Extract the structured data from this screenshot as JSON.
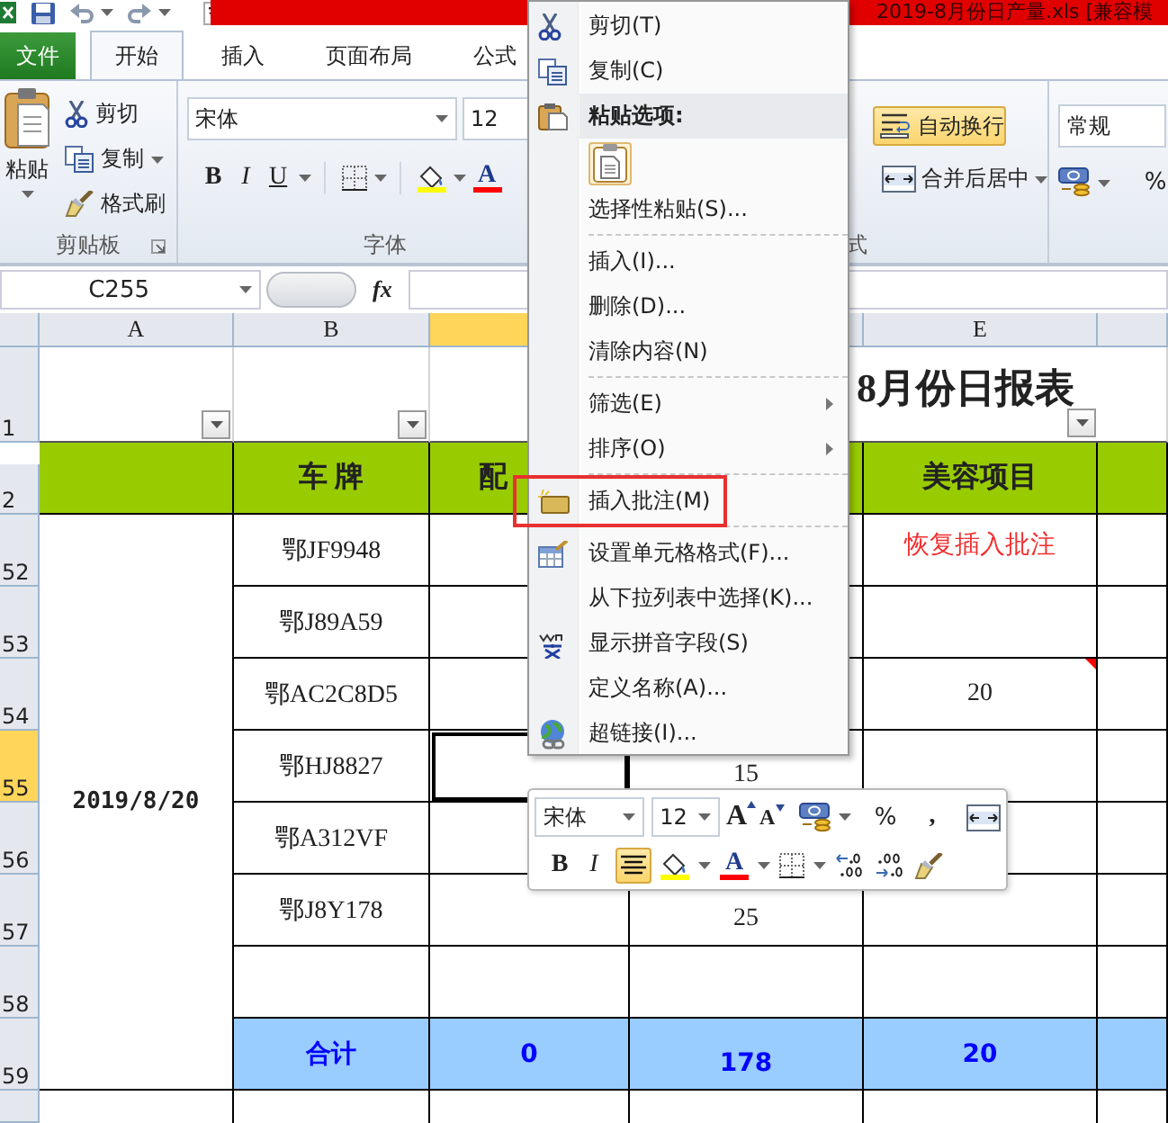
{
  "window": {
    "title": "2019-8月份日产量.xls  [兼容模"
  },
  "tabs": [
    {
      "label": "文件",
      "kind": "file",
      "selected": false
    },
    {
      "label": "开始",
      "kind": "tab",
      "selected": true
    },
    {
      "label": "插入",
      "kind": "tab",
      "selected": false
    },
    {
      "label": "页面布局",
      "kind": "tab",
      "selected": false
    },
    {
      "label": "公式",
      "kind": "tab",
      "selected": false
    }
  ],
  "ribbon": {
    "clipboard": {
      "paste": "粘贴",
      "cut": "剪切",
      "copy": "复制",
      "painter": "格式刷",
      "label": "剪贴板"
    },
    "font": {
      "name": "宋体",
      "size": "12",
      "bold": "B",
      "italic": "I",
      "underline": "U",
      "font_color_button": "A",
      "label": "字体"
    },
    "alignment": {
      "label": "式",
      "wrap": {
        "label": "自动换行",
        "on": true
      },
      "merge": "合并后居中"
    },
    "number": {
      "format": "常规",
      "percent": "%"
    }
  },
  "formula_bar": {
    "name_box": "C255",
    "fx": "fx"
  },
  "sheet": {
    "columns": [
      {
        "label": "A",
        "selected": false
      },
      {
        "label": "B",
        "selected": false
      },
      {
        "selected": true
      },
      {
        "selected": false
      },
      {
        "label": "E",
        "selected": false
      },
      {
        "selected": false
      }
    ],
    "title_row": {
      "number": "1",
      "title": "8月份日报表"
    },
    "header_row": {
      "number": "2",
      "b": "车 牌",
      "c": "配",
      "e": "美容项目"
    },
    "date": "2019/8/20",
    "rows": [
      {
        "number": "52",
        "kind": "data",
        "selected": false,
        "b": "鄂JF9948",
        "e": "恢复插入批注",
        "e_note": true
      },
      {
        "number": "53",
        "kind": "data",
        "selected": false,
        "b": "鄂J89A59"
      },
      {
        "number": "54",
        "kind": "data",
        "selected": false,
        "b": "鄂AC2C8D5",
        "e": "20",
        "comment": true
      },
      {
        "number": "55",
        "kind": "data",
        "selected": true,
        "b": "鄂HJ8827",
        "d": "15"
      },
      {
        "number": "56",
        "kind": "data",
        "selected": false,
        "b": "鄂A312VF"
      },
      {
        "number": "57",
        "kind": "data",
        "selected": false,
        "b": "鄂J8Y178",
        "d": "25"
      },
      {
        "number": "58",
        "kind": "data",
        "selected": false
      },
      {
        "number": "59",
        "kind": "total",
        "selected": false,
        "b": "合计",
        "c": "0",
        "d": "178",
        "e": "20"
      }
    ]
  },
  "context_menu": {
    "items": [
      {
        "kind": "item",
        "label": "剪切(T)"
      },
      {
        "kind": "item",
        "label": "复制(C)"
      },
      {
        "kind": "header",
        "label": "粘贴选项:"
      },
      {
        "kind": "paste-options"
      },
      {
        "kind": "item",
        "label": "选择性粘贴(S)..."
      },
      {
        "kind": "separator"
      },
      {
        "kind": "item",
        "label": "插入(I)..."
      },
      {
        "kind": "item",
        "label": "删除(D)..."
      },
      {
        "kind": "item",
        "label": "清除内容(N)"
      },
      {
        "kind": "separator"
      },
      {
        "kind": "item",
        "label": "筛选(E)",
        "submenu": true
      },
      {
        "kind": "item",
        "label": "排序(O)",
        "submenu": true
      },
      {
        "kind": "separator"
      },
      {
        "kind": "item",
        "label": "插入批注(M)",
        "highlighted": true
      },
      {
        "kind": "separator"
      },
      {
        "kind": "item",
        "label": "设置单元格格式(F)..."
      },
      {
        "kind": "item",
        "label": "从下拉列表中选择(K)..."
      },
      {
        "kind": "item",
        "label": "显示拼音字段(S)"
      },
      {
        "kind": "item",
        "label": "定义名称(A)..."
      },
      {
        "kind": "item",
        "label": "超链接(I)..."
      }
    ]
  },
  "mini_toolbar": {
    "font": "宋体",
    "size": "12",
    "grow": "A",
    "shrink": "A",
    "percent": "%",
    "comma": ",",
    "bold": "B",
    "italic": "I",
    "center": {
      "on": true
    },
    "font_color_button": "A"
  }
}
